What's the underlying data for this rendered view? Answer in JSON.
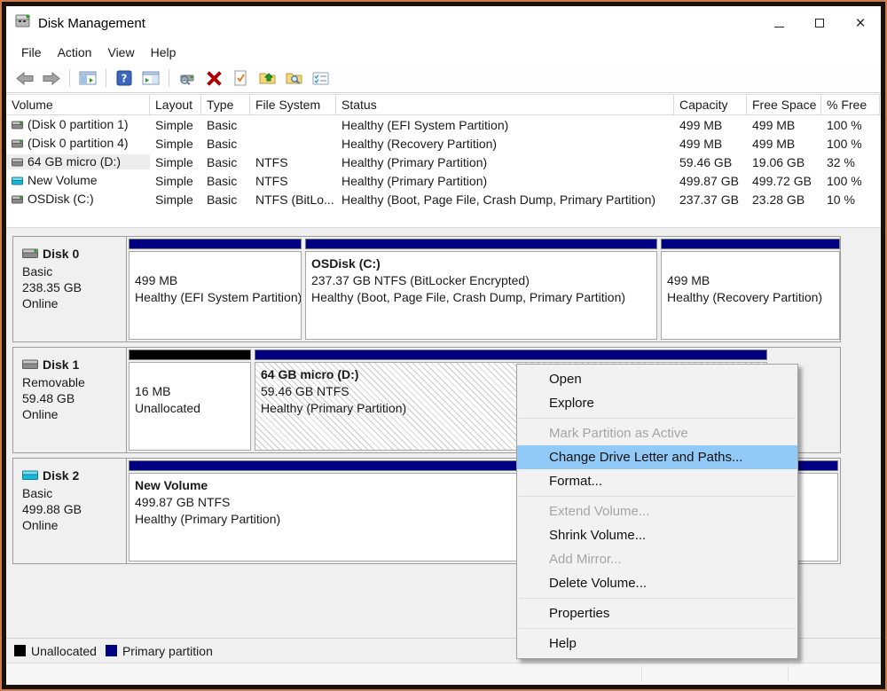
{
  "window": {
    "title": "Disk Management",
    "close_glyph": "×"
  },
  "menubar": {
    "items": [
      "File",
      "Action",
      "View",
      "Help"
    ]
  },
  "toolbar": {
    "icons": [
      "back",
      "forward",
      "show-console-tree",
      "help",
      "show-action-pane",
      "device-properties",
      "delete-volume",
      "check-file",
      "open",
      "explore",
      "properties-list"
    ]
  },
  "colors": {
    "primary_partition": "#000082",
    "unallocated": "#000000",
    "menu_highlight": "#91c9f7",
    "selected_row": "#ededed"
  },
  "volume_table": {
    "columns": [
      "Volume",
      "Layout",
      "Type",
      "File System",
      "Status",
      "Capacity",
      "Free Space",
      "% Free"
    ],
    "rows": [
      {
        "name": "(Disk 0 partition 1)",
        "layout": "Simple",
        "type": "Basic",
        "fs": "",
        "status": "Healthy (EFI System Partition)",
        "capacity": "499 MB",
        "free": "499 MB",
        "pct": "100 %"
      },
      {
        "name": "(Disk 0 partition 4)",
        "layout": "Simple",
        "type": "Basic",
        "fs": "",
        "status": "Healthy (Recovery Partition)",
        "capacity": "499 MB",
        "free": "499 MB",
        "pct": "100 %"
      },
      {
        "name": "64 GB micro (D:)",
        "layout": "Simple",
        "type": "Basic",
        "fs": "NTFS",
        "status": "Healthy (Primary Partition)",
        "capacity": "59.46 GB",
        "free": "19.06 GB",
        "pct": "32 %"
      },
      {
        "name": "New Volume",
        "layout": "Simple",
        "type": "Basic",
        "fs": "NTFS",
        "status": "Healthy (Primary Partition)",
        "capacity": "499.87 GB",
        "free": "499.72 GB",
        "pct": "100 %"
      },
      {
        "name": "OSDisk (C:)",
        "layout": "Simple",
        "type": "Basic",
        "fs": "NTFS (BitLo...",
        "status": "Healthy (Boot, Page File, Crash Dump, Primary Partition)",
        "capacity": "237.37 GB",
        "free": "23.28 GB",
        "pct": "10 %"
      }
    ]
  },
  "disks": [
    {
      "name": "Disk 0",
      "kind": "Basic",
      "size": "238.35 GB",
      "state": "Online",
      "partitions": [
        {
          "title": "",
          "l1": "499 MB",
          "l2": "Healthy (EFI System Partition)"
        },
        {
          "title": "OSDisk  (C:)",
          "l1": "237.37 GB NTFS (BitLocker Encrypted)",
          "l2": "Healthy (Boot, Page File, Crash Dump, Primary Partition)"
        },
        {
          "title": "",
          "l1": "499 MB",
          "l2": "Healthy (Recovery Partition)"
        }
      ]
    },
    {
      "name": "Disk 1",
      "kind": "Removable",
      "size": "59.48 GB",
      "state": "Online",
      "partitions": [
        {
          "title": "",
          "l1": "16 MB",
          "l2": "Unallocated"
        },
        {
          "title": "64 GB micro  (D:)",
          "l1": "59.46 GB NTFS",
          "l2": "Healthy (Primary Partition)"
        }
      ]
    },
    {
      "name": "Disk 2",
      "kind": "Basic",
      "size": "499.88 GB",
      "state": "Online",
      "partitions": [
        {
          "title": "New Volume",
          "l1": "499.87 GB NTFS",
          "l2": "Healthy (Primary Partition)"
        }
      ]
    }
  ],
  "context_menu": {
    "items": [
      {
        "label": "Open",
        "state": "normal"
      },
      {
        "label": "Explore",
        "state": "normal"
      },
      {
        "sep": true
      },
      {
        "label": "Mark Partition as Active",
        "state": "disabled"
      },
      {
        "label": "Change Drive Letter and Paths...",
        "state": "highlighted"
      },
      {
        "label": "Format...",
        "state": "normal"
      },
      {
        "sep": true
      },
      {
        "label": "Extend Volume...",
        "state": "disabled"
      },
      {
        "label": "Shrink Volume...",
        "state": "normal"
      },
      {
        "label": "Add Mirror...",
        "state": "disabled"
      },
      {
        "label": "Delete Volume...",
        "state": "normal"
      },
      {
        "sep": true
      },
      {
        "label": "Properties",
        "state": "normal"
      },
      {
        "sep": true
      },
      {
        "label": "Help",
        "state": "normal"
      }
    ]
  },
  "legend": {
    "items": [
      {
        "label": "Unallocated",
        "color": "#000000"
      },
      {
        "label": "Primary partition",
        "color": "#000082"
      }
    ]
  }
}
